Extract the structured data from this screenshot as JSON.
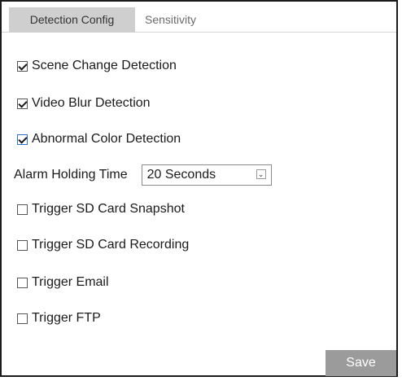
{
  "tabs": [
    {
      "label": "Detection Config",
      "active": true
    },
    {
      "label": "Sensitivity",
      "active": false
    }
  ],
  "options": {
    "scene_change": {
      "label": "Scene Change Detection",
      "checked": true
    },
    "video_blur": {
      "label": "Video Blur Detection",
      "checked": true
    },
    "abnormal_color": {
      "label": "Abnormal Color Detection",
      "checked": true
    },
    "sd_snapshot": {
      "label": "Trigger SD Card Snapshot",
      "checked": false
    },
    "sd_recording": {
      "label": "Trigger SD Card Recording",
      "checked": false
    },
    "email": {
      "label": "Trigger Email",
      "checked": false
    },
    "ftp": {
      "label": "Trigger FTP",
      "checked": false
    }
  },
  "alarm_holding": {
    "label": "Alarm Holding Time",
    "value": "20 Seconds"
  },
  "save_label": "Save",
  "colors": {
    "active_tab_bg": "#cfcfcf",
    "save_button_bg": "#9b9b9b"
  }
}
